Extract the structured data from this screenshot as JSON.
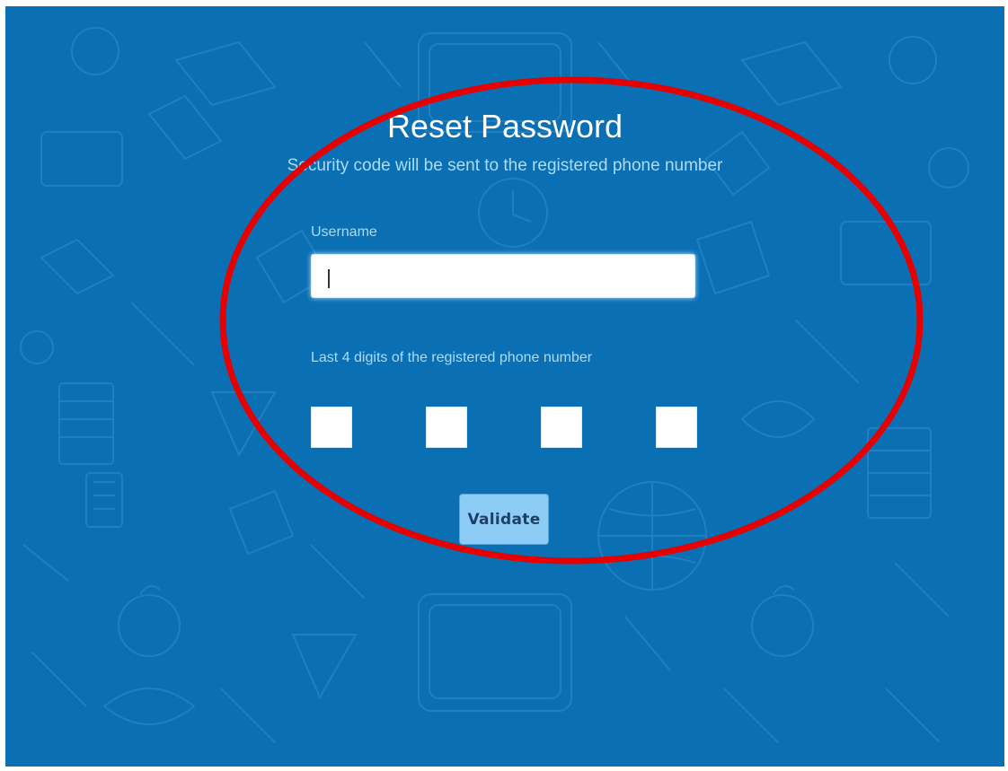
{
  "page": {
    "title": "Reset Password",
    "subtitle": "Security code will be sent to the registered phone number"
  },
  "form": {
    "username_label": "Username",
    "username_value": "",
    "digits_label": "Last 4 digits of the registered phone number",
    "digits": [
      "",
      "",
      "",
      ""
    ],
    "validate_label": "Validate"
  },
  "colors": {
    "background": "#0b6fb4",
    "label_text": "#a9dcf7",
    "button_fill": "#8dcdf5",
    "button_text": "#1d3f66",
    "annotation": "#e60000"
  },
  "background_pattern": "school-doodles"
}
